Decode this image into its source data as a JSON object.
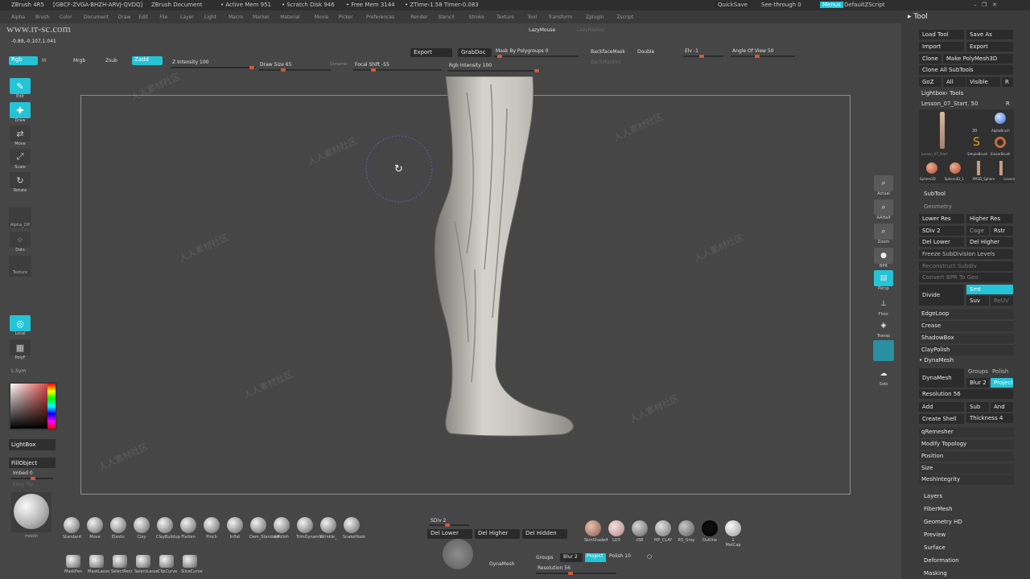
{
  "titlebar": {
    "app": "ZBrush 4R5",
    "serial": "[GBCF-ZVGA-BHZH-ARVJ-QVDQ]",
    "doc": "ZBrush Document",
    "active_mem": "• Active Mem 951",
    "scratch": "• Scratch Disk 946",
    "free_mem": "• Free Mem 3144",
    "ztime": "• ZTime›1.58 Timer›0.083",
    "quicksave": "QuickSave",
    "see_through": "See-through  0",
    "menus": "Menus",
    "default_zscript": "DefaultZScript"
  },
  "menus": [
    "Alpha",
    "Brush",
    "Color",
    "Document",
    "Draw",
    "Edit",
    "File",
    "Layer",
    "Light",
    "Macro",
    "Marker",
    "Material",
    "Movie",
    "Picker",
    "Preferences",
    "Render",
    "Stencil",
    "Stroke",
    "Texture",
    "Tool",
    "Transform",
    "Zplugin",
    "Zscript"
  ],
  "coords": "-0.89,-0.107,1.041",
  "website": "www.rr-sc.com",
  "toolbar": {
    "lazymouse": "LazyMouse",
    "lazyradius": "LazyRadius",
    "export": "Export",
    "grabdoc": "GrabDoc",
    "mask_polygroups": "Mask By Polygroups 0",
    "backfacemask": "BackfaceMask",
    "double": "Double",
    "backmaskint": "BackMaskInt",
    "elv": "Elv -1",
    "angle_of_view": "Angle Of View 50",
    "rgb": "Rgb",
    "m": "M",
    "mrgb": "Mrgb",
    "zsub": "Zsub",
    "zadd": "Zadd",
    "z_intensity": "Z Intensity 100",
    "draw_size": "Draw Size 65",
    "dynamic": "Dynamic",
    "focal_shift": "Focal Shift -55",
    "rgb_intensity": "Rgb Intensity 100"
  },
  "left_tools": {
    "edit": "Edit",
    "draw": "Draw",
    "move": "Move",
    "scale": "Scale",
    "rotate": "Rotate",
    "alpha": "Alpha_Off",
    "dots": "Dots",
    "texture": "Texture",
    "local": "Local",
    "polyf": "PolyF",
    "sym": "L.Sym",
    "lightbox": "LightBox",
    "fillobject": "FillObject",
    "imbed": "Imbed 0",
    "easy_tip": "Easy Tip",
    "smooth": "mooth"
  },
  "right_tools": [
    "Actual",
    "AAHalf",
    "Zoom",
    "BPR",
    "Persp",
    "Floor",
    "Transp",
    "Solo"
  ],
  "tool_panel": {
    "title": "Tool",
    "load_tool": "Load Tool",
    "save_as": "Save As",
    "import": "Import",
    "export": "Export",
    "clone": "Clone",
    "make_polymesh": "Make PolyMesh3D",
    "clone_all": "Clone All SubTools",
    "goz": "GoZ",
    "all": "All",
    "visible": "Visible",
    "r": "R",
    "lightbox_tools": "Lightbox› Tools",
    "current_tool": "Lesson_07_Start. 50",
    "r2": "R",
    "thumbs_row1": [
      "Lesson_07_Start",
      "30",
      "AlphaBrush"
    ],
    "thumbs_row2": [
      "SimpleBrush",
      "EraserBrush"
    ],
    "thumbs_row3": [
      "Sphere3D",
      "Sphere3D_1",
      "PM3D_Sphere",
      "Lesson"
    ],
    "subtool": "SubTool",
    "geometry": "Geometry",
    "lower_res": "Lower Res",
    "higher_res": "Higher Res",
    "sdiv": "SDiv 2",
    "cage": "Cage",
    "rstr": "Rstr",
    "del_lower": "Del Lower",
    "del_higher": "Del Higher",
    "freeze": "Freeze SubDivision Levels",
    "reconstruct": "Reconstruct Subdiv",
    "convert_bpr": "Convert BPR To Geo",
    "divide": "Divide",
    "smt": "Smt",
    "suv": "Suv",
    "reuv": "ReUV",
    "edgeloop": "EdgeLoop",
    "crease": "Crease",
    "shadowbox": "ShadowBox",
    "claypolish": "ClayPolish",
    "dynamesh_header": "DynaMesh",
    "dynamesh_btn": "DynaMesh",
    "groups": "Groups",
    "polish": "Polish",
    "blur": "Blur 2",
    "project": "Project",
    "resolution": "Resolution 56",
    "add": "Add",
    "sub": "Sub",
    "and": "And",
    "create_shell": "Create Shell",
    "thickness": "Thickness 4",
    "qremesher": "qRemesher",
    "modify_topology": "Modify Topology",
    "position": "Position",
    "size": "Size",
    "meshintegrity": "MeshIntegrity",
    "layers": "Layers",
    "fibermesh": "FiberMesh",
    "geometry_hd": "Geometry HD",
    "preview": "Preview",
    "surface": "Surface",
    "deformation": "Deformation",
    "masking": "Masking"
  },
  "brushes": [
    "Standard",
    "Move",
    "Elastic",
    "Clay",
    "ClayBuildup",
    "Flatten",
    "Pinch",
    "Inflat",
    "Dam_Standard",
    "hPolish",
    "TrimDynamic",
    "Wrinkle_",
    "SnakeHook"
  ],
  "bottom_brushes2": [
    "MaskPen",
    "MaskLasso",
    "SelectRect",
    "SelectLasso",
    "ClipCurve",
    "SliceCurve"
  ],
  "bottom_geo": {
    "sdiv": "SDiv 2",
    "del_lower": "Del Lower",
    "del_higher": "Del Higher",
    "del_hidden": "Del Hidden",
    "dynamesh": "DynaMesh",
    "groups": "Groups",
    "blur": "Blur 2",
    "project": "Project",
    "polish": "Polish 10",
    "resolution": "Resolution 56"
  },
  "materials": [
    "SkinShade4",
    "LO3",
    "zSB",
    "MP_CLAY",
    "RS_Grey",
    "Outline",
    "1 MatCap"
  ],
  "colors": {
    "accent": "#25c3d6",
    "background": "#464646",
    "panel": "#3b3b3b"
  }
}
